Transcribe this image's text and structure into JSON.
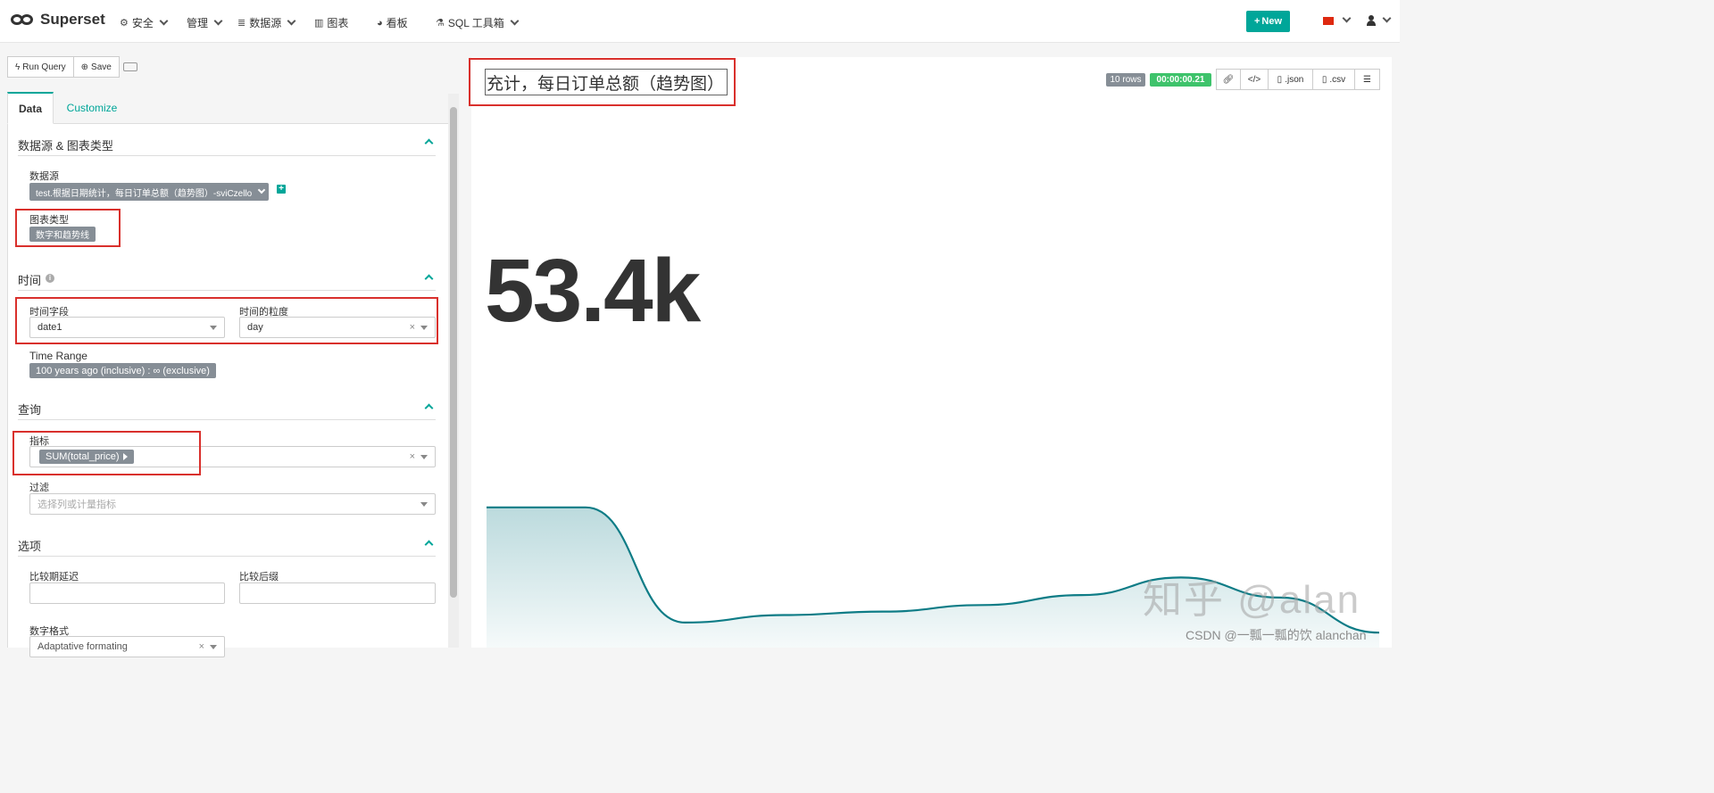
{
  "navbar": {
    "brand": "Superset",
    "items": [
      {
        "label": "安全",
        "icon": "cogs-icon",
        "dropdown": true
      },
      {
        "label": "管理",
        "icon": "",
        "dropdown": true
      },
      {
        "label": "数据源",
        "icon": "database-icon",
        "dropdown": true
      },
      {
        "label": "图表",
        "icon": "bar-chart-icon",
        "dropdown": false
      },
      {
        "label": "看板",
        "icon": "dashboard-icon",
        "dropdown": false
      },
      {
        "label": "SQL 工具箱",
        "icon": "flask-icon",
        "dropdown": true
      }
    ],
    "new_button": "New"
  },
  "query_buttons": {
    "run": "Run Query",
    "save": "Save"
  },
  "tabs": {
    "data": "Data",
    "customize": "Customize"
  },
  "sections": {
    "datasource": {
      "title": "数据源 & 图表类型",
      "datasource_label": "数据源",
      "datasource_value": "test.根据日期统计，每日订单总额（趋势图）-sviCzello",
      "viz_label": "图表类型",
      "viz_value": "数字和趋势线"
    },
    "time": {
      "title": "时间",
      "column_label": "时间字段",
      "column_value": "date1",
      "grain_label": "时间的粒度",
      "grain_value": "day",
      "range_label": "Time Range",
      "range_value": "100 years ago (inclusive) : ∞ (exclusive)"
    },
    "query": {
      "title": "查询",
      "metric_label": "指标",
      "metric_value": "SUM(total_price)",
      "filter_label": "过滤",
      "filter_placeholder": "选择列或计量指标"
    },
    "options": {
      "title": "选项",
      "compare_lag_label": "比较期延迟",
      "compare_suffix_label": "比较后缀",
      "number_format_label": "数字格式",
      "number_format_value": "Adaptative formating"
    }
  },
  "slice": {
    "title": "充计，每日订单总额（趋势图）",
    "rows_badge": "10 rows",
    "time_badge": "00:00:00.21",
    "json_label": ".json",
    "csv_label": ".csv",
    "big_number": "53.4k"
  },
  "chart_data": {
    "type": "area",
    "title": "",
    "xlabel": "",
    "ylabel": "",
    "x": [
      1,
      2,
      3,
      4,
      5,
      6,
      7,
      8,
      9,
      10
    ],
    "values": [
      58000,
      58000,
      35000,
      36500,
      37200,
      38500,
      40500,
      44000,
      40000,
      33000
    ],
    "ylim": [
      30000,
      61000
    ],
    "color": "#0e7c86",
    "fill": "#cde7ea",
    "grid": false,
    "axes_visible": false
  },
  "watermark": {
    "zhihu": "知乎 @alan",
    "csdn": "CSDN @一瓢一瓢的饮 alanchan"
  },
  "colors": {
    "accent": "#00a699",
    "highlight": "#d9302c",
    "tag": "#868e96",
    "success": "#3ec36b"
  }
}
